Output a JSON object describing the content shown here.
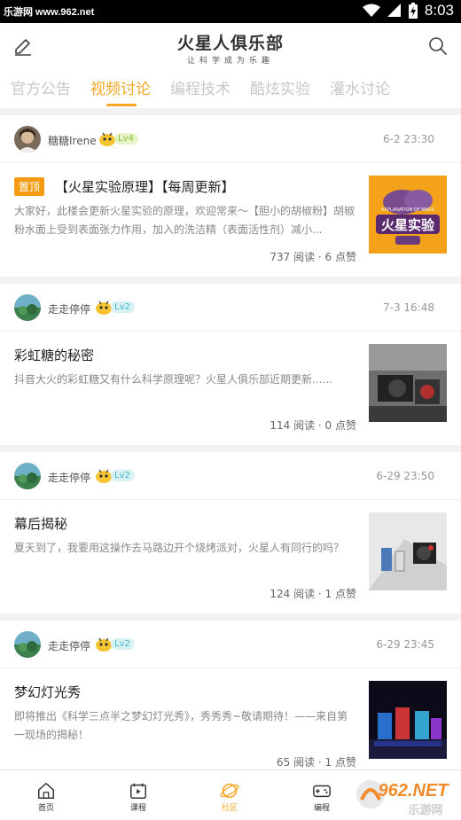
{
  "status": {
    "source": "乐游网 www.962.net",
    "time": "8:03"
  },
  "header": {
    "logo_title": "火星人俱乐部",
    "logo_subtitle": "让科学成为乐趣"
  },
  "tabs": [
    {
      "label": "官方公告",
      "active": false
    },
    {
      "label": "视频讨论",
      "active": true
    },
    {
      "label": "编程技术",
      "active": false
    },
    {
      "label": "酷炫实验",
      "active": false
    },
    {
      "label": "灌水讨论",
      "active": false
    }
  ],
  "posts": [
    {
      "author": "糖糖Irene",
      "level": "Lv4",
      "time": "6-2 23:30",
      "pinned": true,
      "pin_label": "置顶",
      "title": "【火星实验原理】【每周更新】",
      "excerpt": "大家好，此楼会更新火星实验的原理，欢迎常来～【胆小的胡椒粉】胡椒粉水面上受到表面张力作用，加入的洗洁精（表面活性剂）减小...",
      "stats": "737 阅读 · 6 点赞",
      "thumb_title": "火星实验",
      "thumb_caption": "EXPLANATION OF MARS"
    },
    {
      "author": "走走停停",
      "level": "Lv2",
      "time": "7-3 16:48",
      "pinned": false,
      "title": "彩虹糖的秘密",
      "excerpt": "抖音大火的彩虹糖又有什么科学原理呢？火星人俱乐部近期更新......",
      "stats": "114 阅读 · 0 点赞"
    },
    {
      "author": "走走停停",
      "level": "Lv2",
      "time": "6-29 23:50",
      "pinned": false,
      "title": "幕后揭秘",
      "excerpt": "夏天到了，我要用这操作去马路边开个烧烤派对，火星人有同行的吗？",
      "stats": "124 阅读 · 1 点赞"
    },
    {
      "author": "走走停停",
      "level": "Lv2",
      "time": "6-29 23:45",
      "pinned": false,
      "title": "梦幻灯光秀",
      "excerpt": "即将推出《科学三点半之梦幻灯光秀》，秀秀秀~敬请期待！——来自第一现场的揭秘！",
      "stats": "65 阅读 · 1 点赞"
    }
  ],
  "bottom_nav": [
    {
      "label": "首页",
      "icon": "home-icon",
      "active": false
    },
    {
      "label": "课程",
      "icon": "course-icon",
      "active": false
    },
    {
      "label": "社区",
      "icon": "community-planet-icon",
      "active": true
    },
    {
      "label": "编程",
      "icon": "gamepad-icon",
      "active": false
    }
  ],
  "watermark": {
    "brand": "962.NET",
    "sub": "乐游网"
  },
  "colors": {
    "accent": "#f5a623",
    "pin": "#f39c12",
    "lv4": "#8cb83c",
    "lv2": "#3fb6c9"
  }
}
